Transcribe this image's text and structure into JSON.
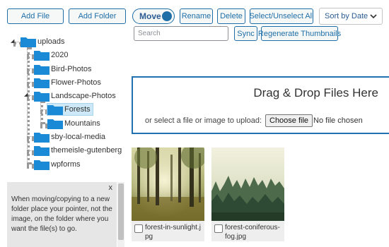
{
  "toolbar": {
    "add_file": "Add File",
    "add_folder": "Add Folder",
    "move": "Move",
    "rename": "Rename",
    "delete": "Delete",
    "select_unselect": "Select/Unselect All",
    "sort": "Sort by Date",
    "search_placeholder": "Search",
    "sync": "Sync",
    "regenerate": "Regenerate Thumbnails"
  },
  "tree": {
    "root": "uploads",
    "folders": [
      {
        "label": "2020"
      },
      {
        "label": "Bird-Photos"
      },
      {
        "label": "Flower-Photos"
      },
      {
        "label": "Landscape-Photos"
      },
      {
        "label": "Forests",
        "selected": true
      },
      {
        "label": "Mountains"
      },
      {
        "label": "sby-local-media"
      },
      {
        "label": "themeisle-gutenberg"
      },
      {
        "label": "wpforms"
      }
    ]
  },
  "dropzone": {
    "title": "Drag & Drop Files Here",
    "subtitle": "or select a file or image to upload:",
    "choose_file": "Choose file",
    "no_file": "No file chosen"
  },
  "files": [
    {
      "name": "forest-in-sunlight.jpg"
    },
    {
      "name": "forest-coniferous-fog.jpg"
    }
  ],
  "tip": {
    "close": "x",
    "text": "When moving/copying to a new folder place your pointer, not the image, on the folder where you want the file(s) to go."
  },
  "colors": {
    "accent": "#1e6fa8",
    "folder": "#1a8ad6",
    "selected_bg": "#cde8f6"
  }
}
